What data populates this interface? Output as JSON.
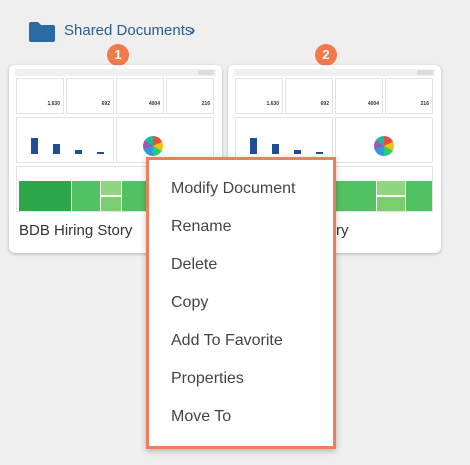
{
  "breadcrumb": {
    "label": "Shared Documents",
    "chevron": "›"
  },
  "badges": [
    "1",
    "2"
  ],
  "cards": [
    {
      "title": "BDB Hiring Story",
      "kpis": [
        "1,630",
        "692",
        "4004",
        "216"
      ]
    },
    {
      "title": "ry",
      "kpis": [
        "1,630",
        "692",
        "4004",
        "216"
      ]
    }
  ],
  "context_menu": {
    "items": [
      "Modify Document",
      "Rename",
      "Delete",
      "Copy",
      "Add To Favorite",
      "Properties",
      "Move To"
    ]
  },
  "colors": {
    "accent": "#ef7e5d",
    "folder": "#2a6aa5",
    "link": "#2b5d8f"
  },
  "icons": {
    "folder": "folder-icon",
    "chevron": "chevron-right-icon"
  }
}
